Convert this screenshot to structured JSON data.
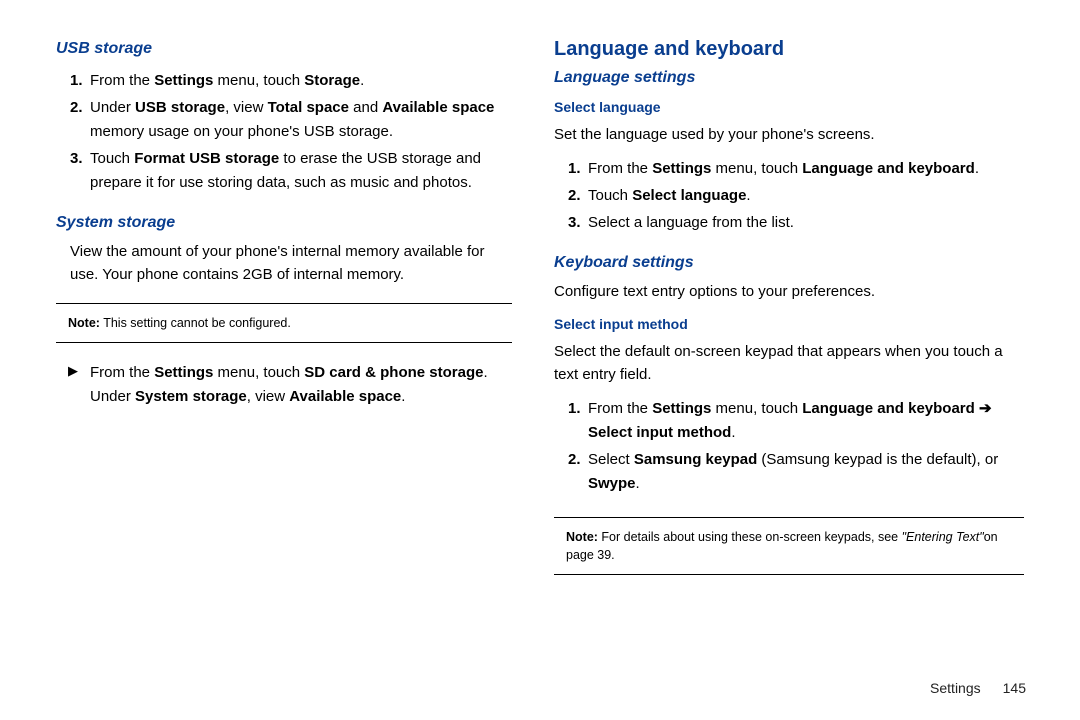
{
  "left": {
    "usb_heading": "USB storage",
    "usb_li1_pre": "From the ",
    "usb_li1_b1": "Settings",
    "usb_li1_mid": " menu, touch ",
    "usb_li1_b2": "Storage",
    "usb_li1_post": ".",
    "usb_li2_pre": "Under ",
    "usb_li2_b1": "USB storage",
    "usb_li2_mid1": ", view ",
    "usb_li2_b2": "Total space",
    "usb_li2_mid2": " and ",
    "usb_li2_b3": "Available space",
    "usb_li2_post": " memory usage on your phone's USB storage.",
    "usb_li3_pre": "Touch ",
    "usb_li3_b1": "Format USB storage",
    "usb_li3_post": " to erase the USB storage and prepare it for use storing data, such as music and photos.",
    "sys_heading": "System storage",
    "sys_body": "View the amount of your phone's internal memory available for use. Your phone contains 2GB of internal memory.",
    "sys_note_label": "Note:",
    "sys_note_text": " This setting cannot be configured.",
    "sys_bullet_pre": "From the ",
    "sys_bullet_b1": "Settings",
    "sys_bullet_mid": " menu, touch ",
    "sys_bullet_b2": "SD card & phone storage",
    "sys_bullet_post1": ". Under ",
    "sys_bullet_b3": "System storage",
    "sys_bullet_post2": ", view ",
    "sys_bullet_b4": "Available space",
    "sys_bullet_post3": "."
  },
  "right": {
    "lk_heading": "Language and keyboard",
    "lang_heading": "Language settings",
    "sel_lang_heading": "Select language",
    "sel_lang_body": "Set the language used by your phone's screens.",
    "sl_li1_pre": "From the ",
    "sl_li1_b1": "Settings",
    "sl_li1_mid": " menu, touch ",
    "sl_li1_b2": "Language and keyboard",
    "sl_li1_post": ".",
    "sl_li2_pre": "Touch ",
    "sl_li2_b1": "Select language",
    "sl_li2_post": ".",
    "sl_li3": "Select a language from the list.",
    "kb_heading": "Keyboard settings",
    "kb_body": "Configure text entry options to your preferences.",
    "sim_heading": "Select input method",
    "sim_body": "Select the default on-screen keypad that appears when you touch a text entry field.",
    "sim_li1_pre": "From the ",
    "sim_li1_b1": "Settings",
    "sim_li1_mid": " menu, touch ",
    "sim_li1_b2": "Language and keyboard",
    "sim_li1_arrow": " ➔ ",
    "sim_li1_b3": "Select input method",
    "sim_li1_post": ".",
    "sim_li2_pre": "Select ",
    "sim_li2_b1": "Samsung keypad",
    "sim_li2_mid": " (Samsung keypad is the default), or ",
    "sim_li2_b2": "Swype",
    "sim_li2_post": ".",
    "note2_label": "Note:",
    "note2_text1": " For details about using these on-screen keypads, see ",
    "note2_ital": "\"Entering Text\"",
    "note2_text2": "on page 39."
  },
  "footer": {
    "section": "Settings",
    "page": "145"
  },
  "markers": {
    "n1": "1.",
    "n2": "2.",
    "n3": "3.",
    "blet": "▶"
  }
}
